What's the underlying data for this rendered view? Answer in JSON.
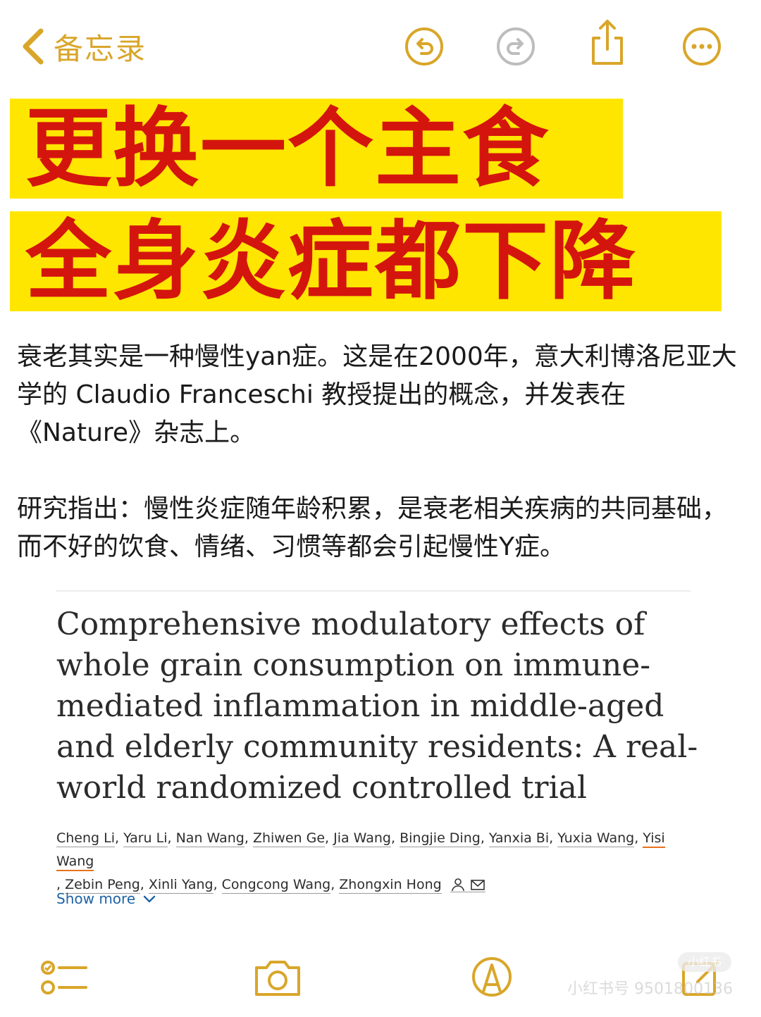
{
  "toolbar": {
    "back_label": "备忘录",
    "accent": "#d9a62a",
    "icons": [
      "undo-icon",
      "redo-icon",
      "share-icon",
      "more-icon"
    ]
  },
  "headline": {
    "line1": "更换一个主食",
    "line2": "全身炎症都下降",
    "highlight_color": "#ffe600",
    "text_color": "#d4150e"
  },
  "body": {
    "paragraph1": "衰老其实是一种慢性yan症。这是在2000年，意大利博洛尼亚大学的 Claudio Franceschi 教授提出的概念，并发表在《Nature》杂志上。",
    "paragraph2": "研究指出：慢性炎症随年龄积累，是衰老相关疾病的共同基础，而不好的饮食、情绪、习惯等都会引起慢性Y症。"
  },
  "paper": {
    "title": "Comprehensive modulatory effects of whole grain consumption on immune-mediated inflammation in middle-aged and elderly community residents: A real-world randomized controlled trial",
    "authors": [
      "Cheng Li",
      "Yaru Li",
      "Nan Wang",
      "Zhiwen Ge",
      "Jia Wang",
      "Bingjie Ding",
      "Yanxia Bi",
      "Yuxia Wang",
      "Yisi Wang",
      "Zebin Peng",
      "Xinli Yang",
      "Congcong Wang",
      "Zhongxin Hong"
    ],
    "show_more_label": "Show more",
    "link_color": "#1f63a6"
  },
  "bottom_toolbar": {
    "icons": [
      "checklist-icon",
      "camera-icon",
      "markup-icon",
      "compose-icon"
    ]
  },
  "watermark": {
    "badge": "小红书",
    "text": "小红书号 9501800136"
  }
}
